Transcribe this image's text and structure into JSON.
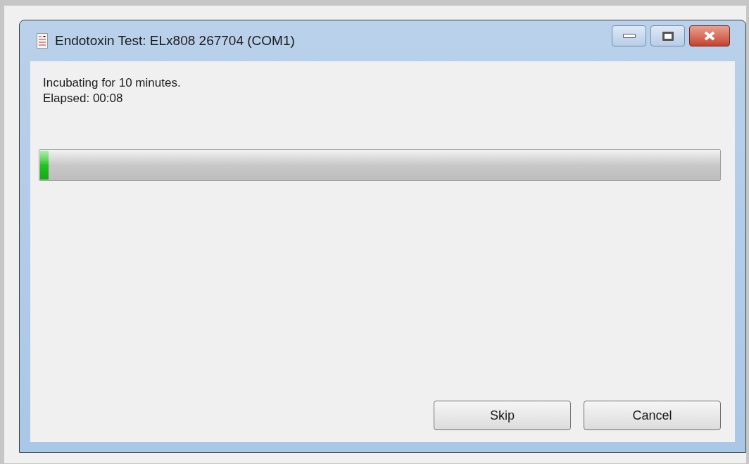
{
  "window": {
    "title": "Endotoxin Test: ELx808 267704 (COM1)"
  },
  "message": [
    "Incubating for 10 minutes.",
    "Elapsed: 00:08"
  ],
  "progress": {
    "level": 0.012
  },
  "buttons": [
    "Skip",
    "Cancel"
  ]
}
